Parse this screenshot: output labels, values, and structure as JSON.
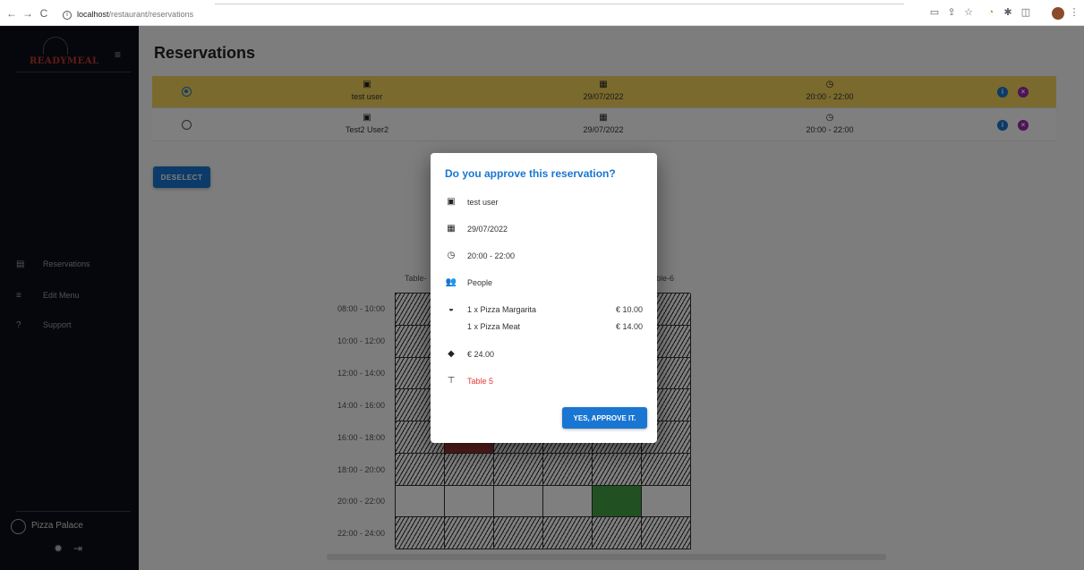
{
  "browser": {
    "url_host": "localhost",
    "url_path": "/restaurant/reservations",
    "back_icon": "←",
    "forward_icon": "→",
    "reload_icon": "C",
    "info_icon": "i"
  },
  "sidebar": {
    "brand": "READYMEAL",
    "items": [
      {
        "label": "Reservations",
        "icon": "▤"
      },
      {
        "label": "Edit Menu",
        "icon": "≡"
      },
      {
        "label": "Support",
        "icon": "?"
      }
    ],
    "user_name": "Pizza Palace"
  },
  "page": {
    "title": "Reservations"
  },
  "reservations": [
    {
      "name": "test user",
      "date": "29/07/2022",
      "time": "20:00 - 22:00",
      "selected": true
    },
    {
      "name": "Test2 User2",
      "date": "29/07/2022",
      "time": "20:00 - 22:00",
      "selected": false
    }
  ],
  "buttons": {
    "deselect": "DESELECT",
    "approve": "YES, APPROVE IT."
  },
  "tables_view": {
    "visible_headers": [
      "Table-",
      "ble-6"
    ],
    "time_slots": [
      "08:00 - 10:00",
      "10:00 - 12:00",
      "12:00 - 14:00",
      "14:00 - 16:00",
      "16:00 - 18:00",
      "18:00 - 20:00",
      "20:00 - 22:00",
      "22:00 - 24:00"
    ]
  },
  "dialog": {
    "title": "Do you approve this reservation?",
    "name": "test user",
    "date": "29/07/2022",
    "time": "20:00 - 22:00",
    "people": "People",
    "order": [
      {
        "item": "1 x Pizza Margarita",
        "price": "€ 10.00"
      },
      {
        "item": "1 x Pizza Meat",
        "price": "€ 14.00"
      }
    ],
    "total": "€ 24.00",
    "table": "Table 5"
  },
  "colors": {
    "primary": "#1976d2",
    "selected_row": "#f4d45c",
    "sidebar": "#0c0f18",
    "danger": "#e53935",
    "available": "#43a047",
    "booked": "#b03a3a"
  }
}
